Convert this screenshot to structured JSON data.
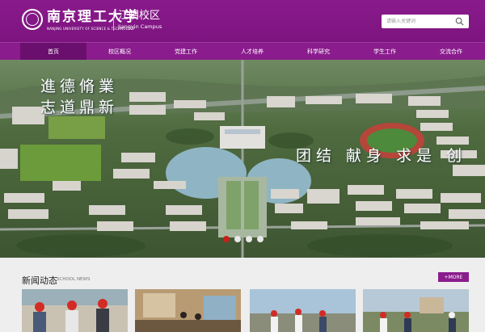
{
  "header": {
    "logo_cn": "南京理工大学",
    "logo_en": "NANJING UNIVERSITY OF SCIENCE & TECHNOLOGY",
    "campus_cn": "江阴校区",
    "campus_en": "Jiangyin Campus"
  },
  "search": {
    "placeholder": "请输入关键词"
  },
  "nav": {
    "items": [
      {
        "label": "首页",
        "active": true
      },
      {
        "label": "校区概况"
      },
      {
        "label": "党建工作"
      },
      {
        "label": "人才培养"
      },
      {
        "label": "科学研究"
      },
      {
        "label": "学生工作"
      },
      {
        "label": "交流合作"
      }
    ]
  },
  "hero": {
    "slogan_left_1": "進德脩業",
    "slogan_left_2": "志道鼎新",
    "slogan_right": "团结 献身 求是 创",
    "slides": 4,
    "active_slide": 1
  },
  "news": {
    "title": "新闻动态",
    "subtitle": "SCHOOL NEWS",
    "more": "+MORE"
  },
  "colors": {
    "brand": "#8a1c8d",
    "nav_active": "#6a0f6e",
    "dot_active": "#c4221b"
  }
}
